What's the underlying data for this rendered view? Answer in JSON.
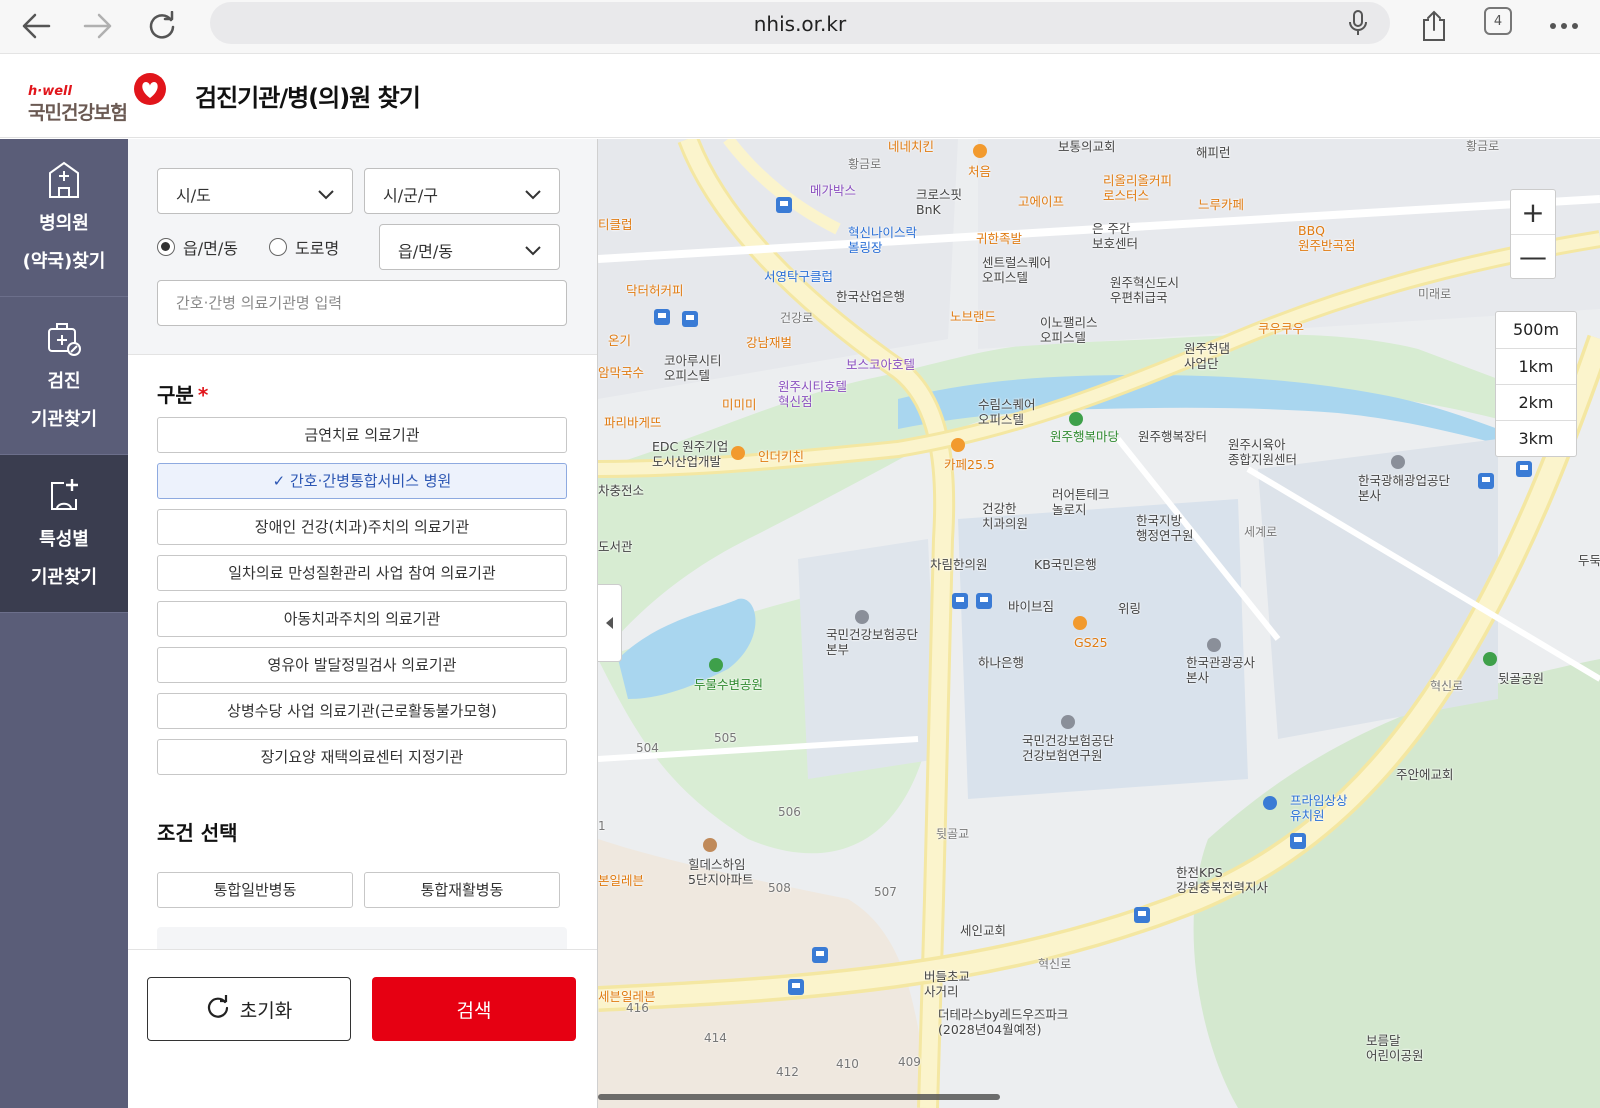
{
  "browser": {
    "url": "nhis.or.kr",
    "tab_count": "4"
  },
  "header": {
    "logo_small": "h·well",
    "logo_main": "국민건강보험",
    "title": "검진기관/병(의)원 찾기"
  },
  "leftnav": {
    "items": [
      {
        "line1": "병의원",
        "line2": "(약국)찾기",
        "icon": "hospital-icon"
      },
      {
        "line1": "검진",
        "line2": "기관찾기",
        "icon": "medical-kit-icon"
      },
      {
        "line1": "특성별",
        "line2": "기관찾기",
        "icon": "clipboard-plus-icon"
      }
    ]
  },
  "filters": {
    "sido": "시/도",
    "sigungu": "시/군/구",
    "radio_eupmyeondong": "읍/면/동",
    "radio_road": "도로명",
    "dong_select": "읍/면/동",
    "name_placeholder": "간호·간병 의료기관명 입력"
  },
  "category": {
    "title": "구분",
    "required_mark": "*",
    "options": [
      "금연치료 의료기관",
      "✓ 간호·간병통합서비스 병원",
      "장애인 건강(치과)주치의 의료기관",
      "일차의료 만성질환관리 사업 참여 의료기관",
      "아동치과주치의 의료기관",
      "영유아 발달정밀검사 의료기관",
      "상병수당 사업 의료기관(근로활동불가모형)",
      "장기요양 재택의료센터 지정기관"
    ]
  },
  "condition": {
    "title": "조건 선택",
    "options": [
      "통합일반병동",
      "통합재활병동"
    ]
  },
  "buttons": {
    "reset": "초기화",
    "search": "검색"
  },
  "map": {
    "zoom_in": "+",
    "zoom_out": "—",
    "scales": [
      "500m",
      "1km",
      "2km",
      "3km"
    ],
    "labels": {
      "l01": "보통의교회",
      "l02": "해피런",
      "l03": "네네치킨",
      "l04": "황금로",
      "l05": "메가박스",
      "l06": "크로스핏\nBnK",
      "l07": "처음",
      "l08": "고에이프",
      "l09": "리올리올커피\n로스터스",
      "l10": "느루카페",
      "l11": "BBQ\n원주반곡점",
      "l12": "티클럽",
      "l13": "혁신나이스락\n볼링장",
      "l14": "귀한족발",
      "l15": "은 주간\n보호센터",
      "l16": "서영탁구클럽",
      "l17": "한국산업은행",
      "l18": "센트럴스퀘어\n오피스텔",
      "l19": "원주혁신도시\n우편취급국",
      "l20": "닥터허커피",
      "l21": "노브랜드",
      "l22": "이노팰리스\n오피스텔",
      "l23": "쿠우쿠우",
      "l24": "미래로",
      "l25": "건강로",
      "l26": "온기",
      "l27": "강남재벌",
      "l28": "보스코아호텔",
      "l29": "원주천댐\n사업단",
      "l30": "코아루시티\n오피스텔",
      "l31": "암막국수",
      "l32": "원주시티호텔\n혁신점",
      "l33": "미미미",
      "l34": "수림스퀘어\n오피스텔",
      "l35": "원주행복마당",
      "l36": "원주행복장터",
      "l37": "원주시육아\n종합지원센터",
      "l38": "파리바게뜨",
      "l39": "EDC 원주기업\n도시산업개발",
      "l40": "인더키친",
      "l41": "카페25.5",
      "l42": "한국광해광업공단\n본사",
      "l43": "차충전소",
      "l44": "건강한\n치과의원",
      "l45": "러어튼테크\n놀로지",
      "l46": "한국지방\n행정연구원",
      "l47": "세계로",
      "l48": "도서관",
      "l49": "차림한의원",
      "l50": "KB국민은행",
      "l51": "두둑",
      "l52": "바이브짐",
      "l53": "위링",
      "l54": "국민건강보험공단\n본부",
      "l55": "GS25",
      "l56": "하나은행",
      "l57": "한국관광공사\n본사",
      "l58": "두물수변공원",
      "l59": "뒷골공원",
      "l60": "혁신로",
      "l61": "504",
      "l62": "505",
      "l63": "국민건강보험공단\n건강보험연구원",
      "l64": "주안에교회",
      "l65": "506",
      "l66": "프라임상상\n유치원",
      "l67": "힐데스하임\n5단지아파트",
      "l68": "본일레븐",
      "l69": "508",
      "l70": "507",
      "l71": "한전KPS\n강원충북전력지사",
      "l72": "뒷골교",
      "l73": "세인교회",
      "l74": "세븐일레븐",
      "l75": "416",
      "l76": "버들초교\n사거리",
      "l77": "혁신로",
      "l78": "더테라스by레드우즈파크\n(2028년04월예정)",
      "l79": "414",
      "l80": "412",
      "l81": "410",
      "l82": "409",
      "l83": "보름달\n어린이공원",
      "l84": "1",
      "l85": "황금로"
    }
  },
  "colors": {
    "brand_red": "#e60012",
    "nav_bg": "#5a5d78",
    "nav_active": "#3a3d4f",
    "selected_blue": "#2c56b3"
  }
}
